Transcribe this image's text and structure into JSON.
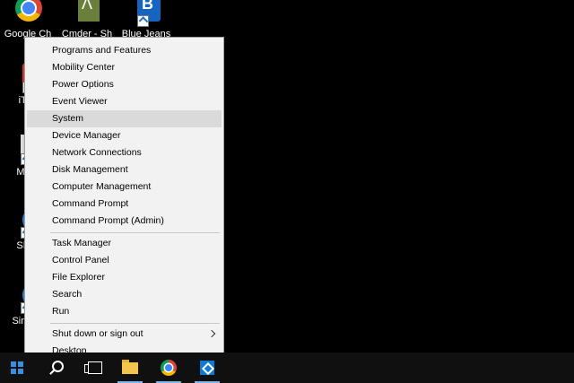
{
  "desktop": {
    "icons": [
      {
        "label": "Google Ch",
        "icon": "chrome-icon"
      },
      {
        "label": "Cmder - Sh",
        "icon": "cmder-icon"
      },
      {
        "label": "Blue Jeans",
        "icon": "bluejeans-icon"
      },
      {
        "label": "iTu",
        "icon": "itunes-icon"
      },
      {
        "label": "Mo",
        "icon": "app-icon"
      },
      {
        "label": "SH",
        "icon": "app-icon"
      },
      {
        "label": "Simp",
        "icon": "app-icon"
      }
    ]
  },
  "menu": {
    "items": [
      {
        "label": "Programs and Features"
      },
      {
        "label": "Mobility Center"
      },
      {
        "label": "Power Options"
      },
      {
        "label": "Event Viewer"
      },
      {
        "label": "System",
        "highlighted": true
      },
      {
        "label": "Device Manager"
      },
      {
        "label": "Network Connections"
      },
      {
        "label": "Disk Management"
      },
      {
        "label": "Computer Management"
      },
      {
        "label": "Command Prompt"
      },
      {
        "label": "Command Prompt (Admin)"
      },
      {
        "label": "Task Manager"
      },
      {
        "label": "Control Panel"
      },
      {
        "label": "File Explorer"
      },
      {
        "label": "Search"
      },
      {
        "label": "Run"
      },
      {
        "label": "Shut down or sign out",
        "submenu": true
      },
      {
        "label": "Desktop"
      }
    ]
  },
  "taskbar": {
    "buttons": [
      {
        "icon": "start-icon"
      },
      {
        "icon": "search-icon"
      },
      {
        "icon": "task-view-icon"
      },
      {
        "icon": "file-explorer-icon",
        "active": true
      },
      {
        "icon": "chrome-icon",
        "active": true
      },
      {
        "icon": "visual-studio-icon",
        "active": true
      }
    ]
  },
  "colors": {
    "accent": "#3b8fe0",
    "menu_bg": "#f2f2f2",
    "highlight": "#dadada",
    "taskbar": "#101010"
  }
}
